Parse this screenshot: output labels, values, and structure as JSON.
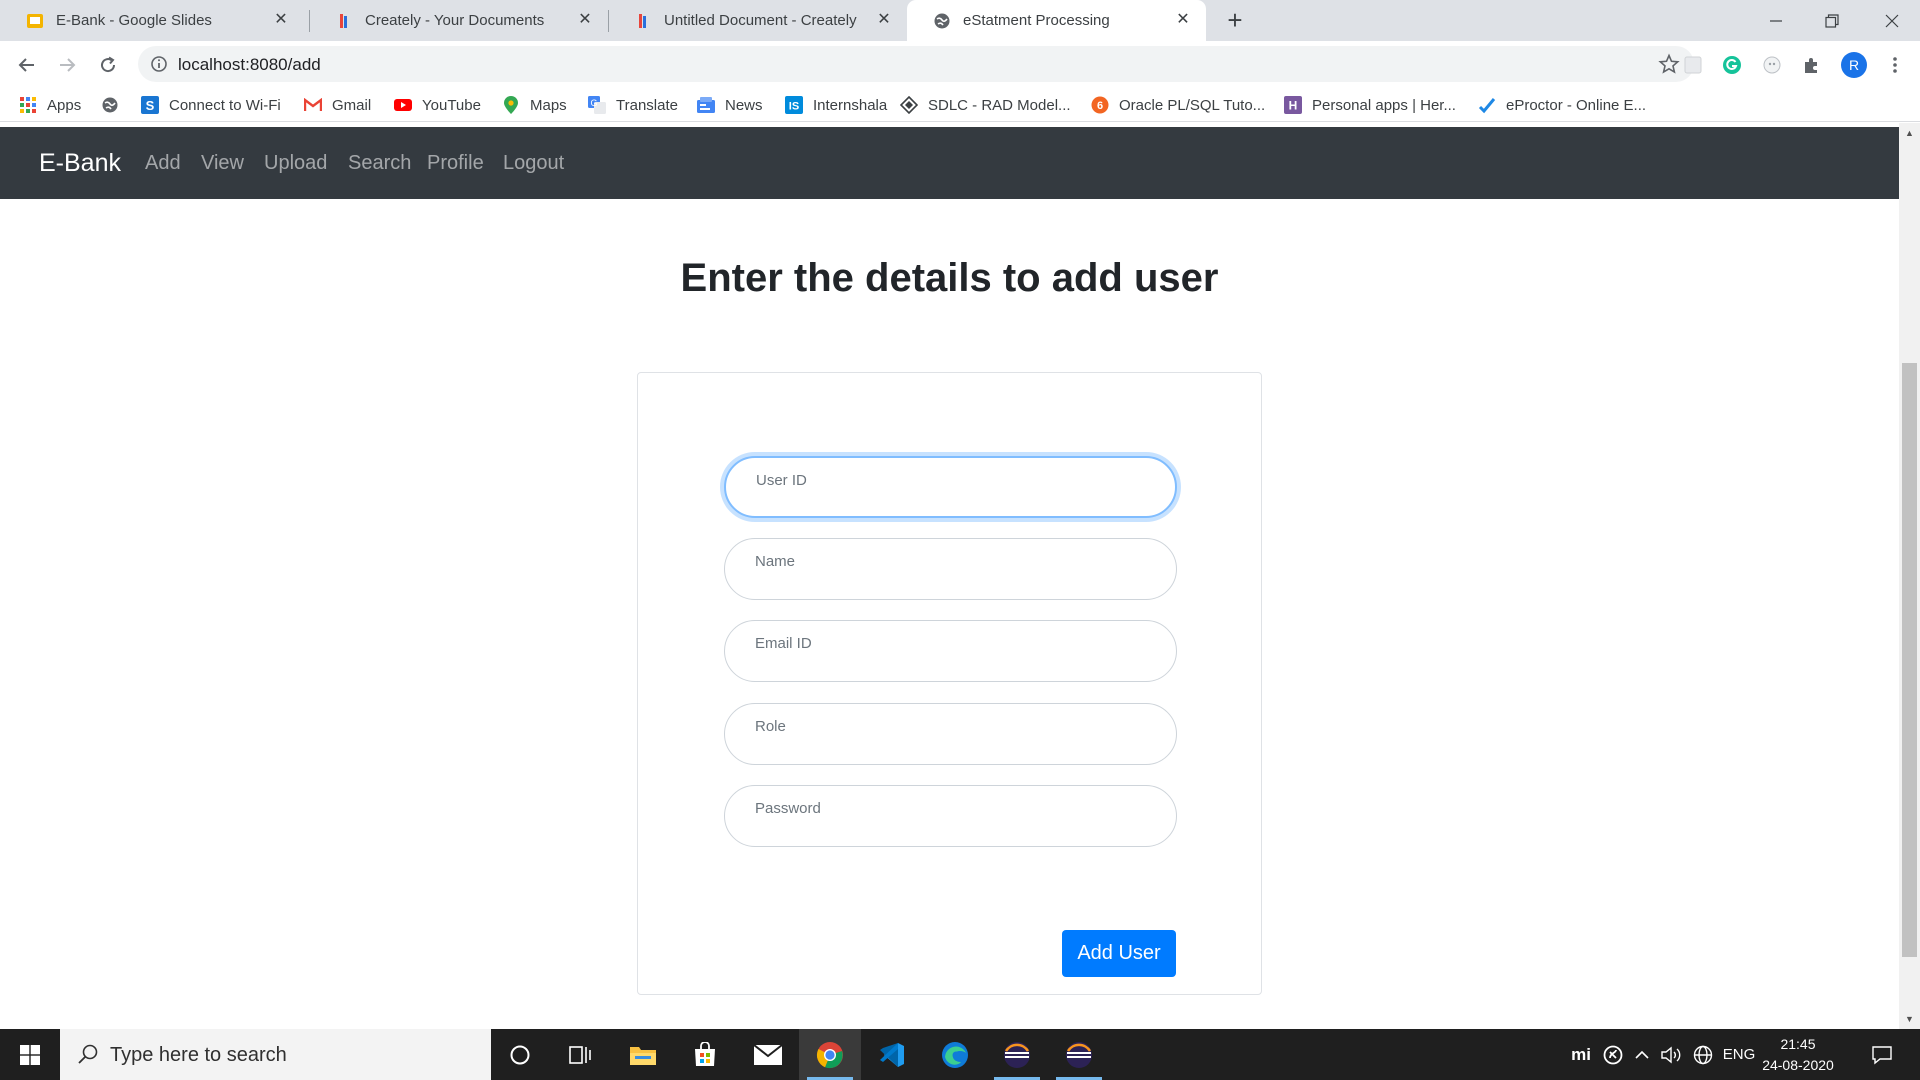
{
  "browser": {
    "tabs": [
      {
        "title": "E-Bank - Google Slides",
        "icon": "google-slides-icon",
        "active": false
      },
      {
        "title": "Creately - Your Documents",
        "icon": "creately-icon",
        "active": false
      },
      {
        "title": "Untitled Document - Creately",
        "icon": "creately-icon",
        "active": false
      },
      {
        "title": "eStatment Processing",
        "icon": "globe-icon",
        "active": true
      }
    ],
    "url": "localhost:8080/add",
    "profile_initial": "R",
    "bookmarks": [
      {
        "label": "Apps",
        "icon": "apps-grid-icon"
      },
      {
        "label": "",
        "icon": "globe-icon"
      },
      {
        "label": "Connect to Wi-Fi",
        "icon": "wifi-s-icon"
      },
      {
        "label": "Gmail",
        "icon": "gmail-icon"
      },
      {
        "label": "YouTube",
        "icon": "youtube-icon"
      },
      {
        "label": "Maps",
        "icon": "maps-pin-icon"
      },
      {
        "label": "Translate",
        "icon": "translate-icon"
      },
      {
        "label": "News",
        "icon": "news-icon"
      },
      {
        "label": "Internshala",
        "icon": "internshala-icon"
      },
      {
        "label": "SDLC - RAD Model...",
        "icon": "diamond-icon"
      },
      {
        "label": "Oracle PL/SQL Tuto...",
        "icon": "oracle-icon"
      },
      {
        "label": "Personal apps | Her...",
        "icon": "heroku-icon"
      },
      {
        "label": "eProctor - Online E...",
        "icon": "eproctor-icon"
      }
    ]
  },
  "app": {
    "brand": "E-Bank",
    "nav": [
      "Add",
      "View",
      "Upload",
      "Search",
      "Profile",
      "Logout"
    ],
    "title": "Enter the details to add user",
    "fields": [
      {
        "label": "User ID",
        "value": ""
      },
      {
        "label": "Name",
        "value": ""
      },
      {
        "label": "Email ID",
        "value": ""
      },
      {
        "label": "Role",
        "value": ""
      },
      {
        "label": "Password",
        "value": ""
      }
    ],
    "submit_label": "Add User",
    "colors": {
      "navbar": "#343a40",
      "primary": "#007bff",
      "focus_ring": "#80bdff"
    }
  },
  "taskbar": {
    "search_placeholder": "Type here to search",
    "apps": [
      "cortana-icon",
      "task-view-icon",
      "file-explorer-icon",
      "store-icon",
      "mail-icon",
      "chrome-icon",
      "vscode-icon",
      "edge-icon",
      "eclipse-icon",
      "eclipse-icon"
    ],
    "language": "ENG",
    "time": "21:45",
    "date": "24-08-2020"
  }
}
